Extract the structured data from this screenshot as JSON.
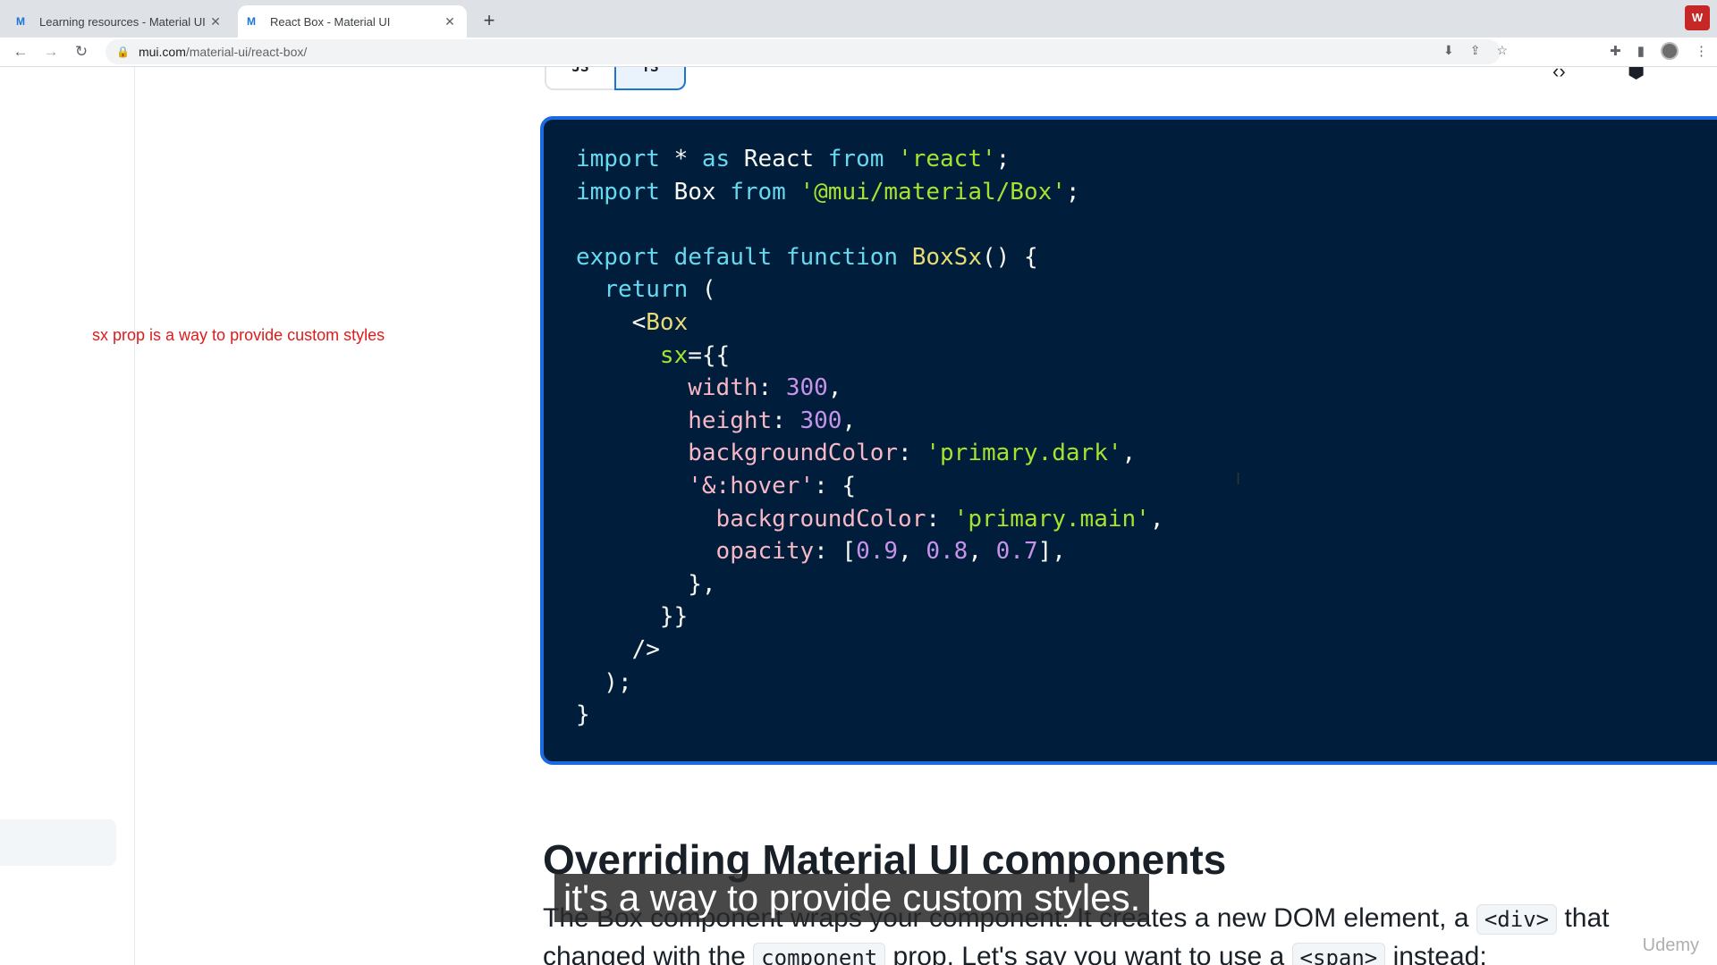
{
  "browser": {
    "tabs": [
      {
        "title": "Learning resources - Material UI",
        "favicon": "mui-logo-icon",
        "active": false
      },
      {
        "title": "React Box - Material UI",
        "favicon": "mui-logo-icon",
        "active": true
      }
    ],
    "new_tab_glyph": "+",
    "extension_badge": "W",
    "address": {
      "host": "mui.com",
      "path": "/material-ui/react-box/"
    }
  },
  "page": {
    "toggle": {
      "js": "JS",
      "ts": "TS"
    },
    "annotation": "sx prop is a way to provide custom styles",
    "code_lines": [
      "import * as React from 'react';",
      "import Box from '@mui/material/Box';",
      "",
      "export default function BoxSx() {",
      "  return (",
      "    <Box",
      "      sx={{",
      "        width: 300,",
      "        height: 300,",
      "        backgroundColor: 'primary.dark',",
      "        '&:hover': {",
      "          backgroundColor: 'primary.main',",
      "          opacity: [0.9, 0.8, 0.7],",
      "        },",
      "      }}",
      "    />",
      "  );",
      "}"
    ],
    "section_heading": "Overriding Material UI components",
    "paragraph": {
      "line1_before": "The Box component wraps your component. It creates a new DOM element, a ",
      "line1_code": "<div>",
      "line1_after": " that",
      "line2_before": "changed with the ",
      "line2_code": "component",
      "line2_middle": " prop. Let's say you want to use a ",
      "line2_code2": "<span>",
      "line2_after": " instead:"
    },
    "subtitle": "it's a way to provide custom styles.",
    "watermark": "Udemy"
  },
  "colors": {
    "code_background": "#001e3c",
    "code_border": "#1b6ae0",
    "annotation": "#e01b1b"
  }
}
